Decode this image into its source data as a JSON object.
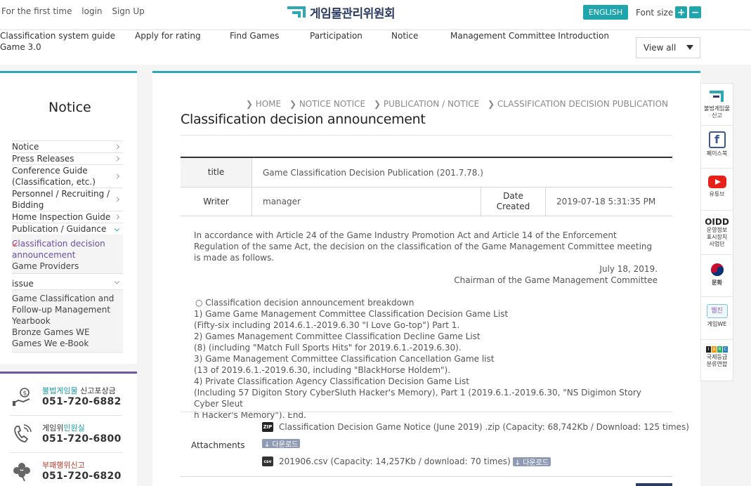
{
  "header": {
    "utility": [
      "For the first time",
      "login",
      "Sign Up"
    ],
    "logo_text": "게임물관리위원회",
    "english_label": "ENGLISH",
    "font_size_label": "Font size",
    "font_plus": "+",
    "font_minus": "−",
    "gnb": {
      "classification_line1": "Classification system guide",
      "classification_line2": "Game 3.0",
      "apply": "Apply for rating",
      "find": "Find Games",
      "participation": "Participation",
      "notice": "Notice",
      "management": "Management Committee Introduction"
    },
    "view_all": "View all"
  },
  "sidebar": {
    "title": "Notice",
    "items": [
      {
        "label": "Notice"
      },
      {
        "label": "Press Releases"
      },
      {
        "label": "Conference Guide (Classification, etc.)"
      },
      {
        "label": "Personnel / Recruiting / Bidding"
      },
      {
        "label": "Home Inspection Guide"
      },
      {
        "label": "Publication / Guidance"
      }
    ],
    "sub_active": "Classification decision announcement",
    "sub_2": "Game Providers",
    "issue": "issue",
    "more": [
      "Game Classification and Follow-up Management Yearbook",
      "Bronze Games WE",
      "Games We e-Book"
    ]
  },
  "contacts": [
    {
      "label_a": "불법게임물",
      "label_b": " 신고포상금",
      "number": "051-720-6882",
      "icon": "money-icon"
    },
    {
      "label_a": "게임위",
      "label_b": "민원실",
      "number": "051-720-6800",
      "icon": "phone-icon"
    },
    {
      "label_a": "부패행위신고",
      "label_b": "",
      "number": "051-720-6820",
      "icon": "clover-icon"
    }
  ],
  "breadcrumb": [
    "HOME",
    "NOTICE NOTICE",
    "PUBLICATION / NOTICE",
    "CLASSIFICATION DECISION PUBLICATION"
  ],
  "page_title": "Classification decision announcement",
  "board": {
    "title_label": "title",
    "title_value": "Game Classification Decision Publication (201.7.78.)",
    "writer_label": "Writer",
    "writer_value": "manager",
    "date_label": "Date Created",
    "date_value": "2019-07-18 5:31:35 PM"
  },
  "content": {
    "p1": "In accordance with Article 24 of the Game Industry Promotion Act and Article 14 of the Enforcement Regulation of the same Act, the decision on the classification of the Game Management Committee meeting is made as follows.",
    "date": "July 18, 2019.",
    "signer": "Chairman of the Game Management Committee",
    "breakdown_title": "○ Classification decision announcement breakdown",
    "lines": [
      "1) Game Game Management Committee Classification Decision Game List",
      "(Fifty-six including 2014.6.1.-2019.6.30 \"I Love Go-top\") Part 1.",
      "2) Games Management Committee Classification Decline Game List",
      "(8) (including \"Match Full Sports Hits\" for 2019.6.1.-2019.6.30).",
      "3) Game Management Committee Classification Cancellation Game list",
      "(13 of 2019.6.1.-2019.6.30, including \"BlackHorse Holdem\").",
      "4) Private Classification Agency Classification Decision Game List",
      "(Including 57 Digiton Story CyberSluth Hacker's Memory), Part 1 (2019.6.1.-2019.6.30, \"NS Digimon Story Cyber Sleut",
      "h Hacker's Memory\"). End."
    ]
  },
  "attachments": {
    "label": "Attachments",
    "file1": "Classification Decision Game Notice (June 2019) .zip (Capacity: 68,742Kb / Download: 125 times)",
    "file1_type": "ZIP",
    "file2": "201906.csv (Capacity: 14,257Kb / download: 70 times)",
    "file2_type": "csv",
    "download": "↓ 다운로드"
  },
  "quick_menu": [
    {
      "label": "불법게임물\n신고",
      "icon": "report-icon"
    },
    {
      "label": "페이스북",
      "icon": "facebook-icon"
    },
    {
      "label": "유튜브",
      "icon": "youtube-icon"
    },
    {
      "label": "운영정보\n표시장치\n사업단",
      "icon": "oidd-icon",
      "mark": "OIDD"
    },
    {
      "label": "문화체육관광부",
      "icon": "korea-emblem-icon"
    },
    {
      "label": "게임WE",
      "icon": "gamewe-icon",
      "mark": "웹진"
    },
    {
      "label": "국제등급\n분류연합",
      "icon": "iarc-icon",
      "mark": "IARC"
    }
  ]
}
